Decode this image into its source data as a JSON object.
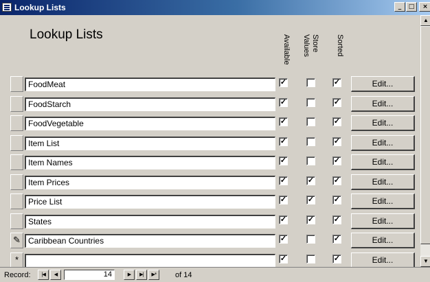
{
  "window": {
    "title": "Lookup Lists",
    "buttons": {
      "minimize": "_",
      "maximize": "□",
      "close": "×"
    }
  },
  "form": {
    "heading": "Lookup Lists",
    "columns": {
      "available": "Available",
      "store_values_line1": "Store",
      "store_values_line2": "Values",
      "sorted": "Sorted"
    },
    "edit_label": "Edit...",
    "rows": [
      {
        "name": "FoodMeat",
        "available": true,
        "store_values": false,
        "sorted": true,
        "selector": ""
      },
      {
        "name": "FoodStarch",
        "available": true,
        "store_values": false,
        "sorted": true,
        "selector": ""
      },
      {
        "name": "FoodVegetable",
        "available": true,
        "store_values": false,
        "sorted": true,
        "selector": ""
      },
      {
        "name": "Item List",
        "available": true,
        "store_values": false,
        "sorted": true,
        "selector": ""
      },
      {
        "name": "Item Names",
        "available": true,
        "store_values": false,
        "sorted": true,
        "selector": ""
      },
      {
        "name": "Item Prices",
        "available": true,
        "store_values": true,
        "sorted": true,
        "selector": ""
      },
      {
        "name": "Price List",
        "available": true,
        "store_values": true,
        "sorted": true,
        "selector": ""
      },
      {
        "name": "States",
        "available": true,
        "store_values": true,
        "sorted": true,
        "selector": ""
      },
      {
        "name": "Caribbean Countries",
        "available": true,
        "store_values": false,
        "sorted": true,
        "selector": "✎"
      },
      {
        "name": "",
        "available": true,
        "store_values": false,
        "sorted": true,
        "selector": "*"
      }
    ]
  },
  "navigation": {
    "record_label": "Record:",
    "current_record": "14",
    "of_text": "of 14",
    "first": "|◀",
    "prev": "◀",
    "next": "▶",
    "last": "▶|",
    "new": "▶*"
  },
  "scrollbar": {
    "up": "▲",
    "down": "▼"
  }
}
